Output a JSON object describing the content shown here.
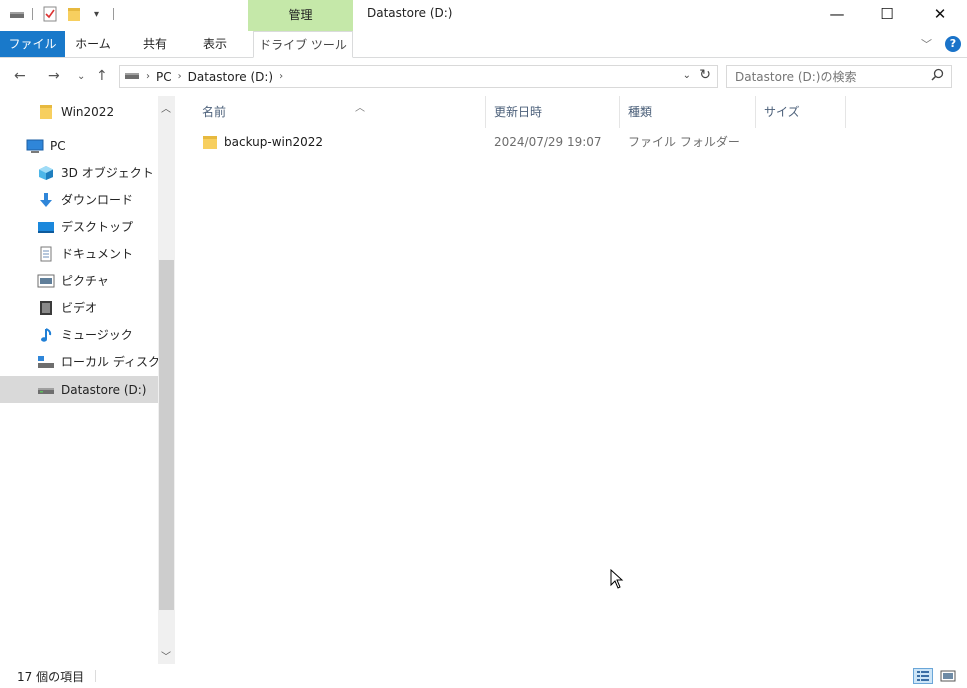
{
  "titlebar": {
    "context_tab": "管理",
    "window_title": "Datastore (D:)",
    "minimize": "—",
    "maximize": "☐",
    "close": "✕"
  },
  "ribbon": {
    "tabs": [
      {
        "label": "ファイル"
      },
      {
        "label": "ホーム"
      },
      {
        "label": "共有"
      },
      {
        "label": "表示"
      },
      {
        "label": "ドライブ ツール"
      }
    ],
    "help": "?"
  },
  "address": {
    "breadcrumbs": [
      "PC",
      "Datastore (D:)"
    ],
    "search_placeholder": "Datastore (D:)の検索"
  },
  "nav": {
    "items": [
      {
        "label": "Win2022",
        "icon": "folder-icon"
      },
      {
        "label": "PC",
        "icon": "pc-icon"
      },
      {
        "label": "3D オブジェクト",
        "icon": "3d-objects-icon"
      },
      {
        "label": "ダウンロード",
        "icon": "download-icon"
      },
      {
        "label": "デスクトップ",
        "icon": "desktop-icon"
      },
      {
        "label": "ドキュメント",
        "icon": "document-icon"
      },
      {
        "label": "ピクチャ",
        "icon": "pictures-icon"
      },
      {
        "label": "ビデオ",
        "icon": "video-icon"
      },
      {
        "label": "ミュージック",
        "icon": "music-icon"
      },
      {
        "label": "ローカル ディスク (C",
        "icon": "local-disk-icon"
      },
      {
        "label": "Datastore (D:)",
        "icon": "drive-icon"
      }
    ]
  },
  "content": {
    "columns": [
      "名前",
      "更新日時",
      "種類",
      "サイズ"
    ],
    "rows": [
      {
        "name": "backup-win2022",
        "modified": "2024/07/29 19:07",
        "type": "ファイル フォルダー",
        "size": ""
      }
    ]
  },
  "status": {
    "item_count": "17 個の項目"
  },
  "colors": {
    "file_tab": "#1979ca",
    "manage_tab": "#c5e8a9",
    "selection": "#d9d9d9",
    "folder": "#f7cf5f"
  }
}
